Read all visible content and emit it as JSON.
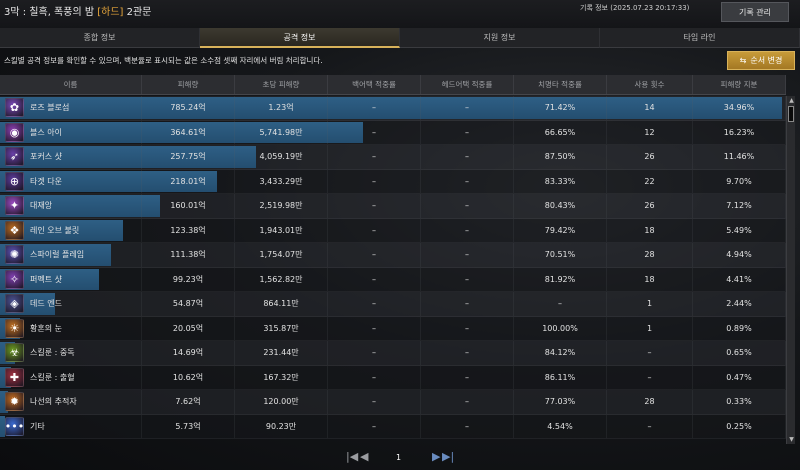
{
  "header": {
    "title_prefix": "3막 : 칠흑, 폭풍의 밤",
    "difficulty": "[하드]",
    "gate": "2관문",
    "record_info": "기록 정보 (2025.07.23 20:17:33)",
    "record_button": "기록 관리"
  },
  "tabs": [
    {
      "label": "종합 정보",
      "active": false
    },
    {
      "label": "공격 정보",
      "active": true
    },
    {
      "label": "지원 정보",
      "active": false
    },
    {
      "label": "타임 라인",
      "active": false
    }
  ],
  "description": "스킬별 공격 정보를 확인할 수 있으며, 백분율로 표시되는 값은 소수점 셋째 자리에서 버림 처리합니다.",
  "order_button": "순서 변경",
  "table": {
    "columns": [
      "이름",
      "피해량",
      "초당 피해량",
      "백어택 적중률",
      "헤드어택 적중률",
      "치명타 적중률",
      "사용 횟수",
      "피해량 지분"
    ],
    "rows": [
      {
        "name": "로즈 블로섬",
        "damage": "785.24억",
        "dps": "1.23억",
        "back": "–",
        "head": "–",
        "crit": "71.42%",
        "uses": "14",
        "share": "34.96%",
        "bar": 1.0,
        "icon": "rose-blossom-icon",
        "color": "#7a4ab8"
      },
      {
        "name": "블스 아이",
        "damage": "364.61억",
        "dps": "5,741.98만",
        "back": "–",
        "head": "–",
        "crit": "66.65%",
        "uses": "12",
        "share": "16.23%",
        "bar": 0.464,
        "icon": "bulls-eye-icon",
        "color": "#8a3fb0"
      },
      {
        "name": "포커스 샷",
        "damage": "257.75억",
        "dps": "4,059.19만",
        "back": "–",
        "head": "–",
        "crit": "87.50%",
        "uses": "26",
        "share": "11.46%",
        "bar": 0.328,
        "icon": "focus-shot-icon",
        "color": "#6a40a8"
      },
      {
        "name": "타겟 다운",
        "damage": "218.01억",
        "dps": "3,433.29만",
        "back": "–",
        "head": "–",
        "crit": "83.33%",
        "uses": "22",
        "share": "9.70%",
        "bar": 0.278,
        "icon": "target-down-icon",
        "color": "#5a3a98"
      },
      {
        "name": "대재앙",
        "damage": "160.01억",
        "dps": "2,519.98만",
        "back": "–",
        "head": "–",
        "crit": "80.43%",
        "uses": "26",
        "share": "7.12%",
        "bar": 0.204,
        "icon": "catastrophe-icon",
        "color": "#9a4ac0"
      },
      {
        "name": "레인 오브 불릿",
        "damage": "123.38억",
        "dps": "1,943.01만",
        "back": "–",
        "head": "–",
        "crit": "79.42%",
        "uses": "18",
        "share": "5.49%",
        "bar": 0.157,
        "icon": "rain-of-bullets-icon",
        "color": "#b86a20"
      },
      {
        "name": "스파이럴 플레임",
        "damage": "111.38억",
        "dps": "1,754.07만",
        "back": "–",
        "head": "–",
        "crit": "70.51%",
        "uses": "28",
        "share": "4.94%",
        "bar": 0.142,
        "icon": "spiral-flame-icon",
        "color": "#5a50b0"
      },
      {
        "name": "퍼펙트 샷",
        "damage": "99.23억",
        "dps": "1,562.82만",
        "back": "–",
        "head": "–",
        "crit": "81.92%",
        "uses": "18",
        "share": "4.41%",
        "bar": 0.126,
        "icon": "perfect-shot-icon",
        "color": "#8040b0"
      },
      {
        "name": "데드 엔드",
        "damage": "54.87억",
        "dps": "864.11만",
        "back": "–",
        "head": "–",
        "crit": "–",
        "uses": "1",
        "share": "2.44%",
        "bar": 0.07,
        "icon": "dead-end-icon",
        "color": "#4a5090"
      },
      {
        "name": "황혼의 눈",
        "damage": "20.05억",
        "dps": "315.87만",
        "back": "–",
        "head": "–",
        "crit": "100.00%",
        "uses": "1",
        "share": "0.89%",
        "bar": 0.026,
        "icon": "twilight-eye-icon",
        "color": "#c07020"
      },
      {
        "name": "스킬룬 : 중독",
        "damage": "14.69억",
        "dps": "231.44만",
        "back": "–",
        "head": "–",
        "crit": "84.12%",
        "uses": "–",
        "share": "0.65%",
        "bar": 0.019,
        "icon": "rune-poison-icon",
        "color": "#6a9a20"
      },
      {
        "name": "스킬룬 : 출혈",
        "damage": "10.62억",
        "dps": "167.32만",
        "back": "–",
        "head": "–",
        "crit": "86.11%",
        "uses": "–",
        "share": "0.47%",
        "bar": 0.014,
        "icon": "rune-bleed-icon",
        "color": "#a03040"
      },
      {
        "name": "나선의 추적자",
        "damage": "7.62억",
        "dps": "120.00만",
        "back": "–",
        "head": "–",
        "crit": "77.03%",
        "uses": "28",
        "share": "0.33%",
        "bar": 0.01,
        "icon": "spiral-tracker-icon",
        "color": "#c06a20"
      },
      {
        "name": "기타",
        "damage": "5.73억",
        "dps": "90.23만",
        "back": "–",
        "head": "–",
        "crit": "4.54%",
        "uses": "–",
        "share": "0.25%",
        "bar": 0.007,
        "icon": "etc-icon",
        "color": "#3a6ad0"
      }
    ]
  },
  "pagination": {
    "first": "|◀",
    "prev": "◀",
    "page": "1",
    "next": "▶",
    "last": "▶|"
  }
}
